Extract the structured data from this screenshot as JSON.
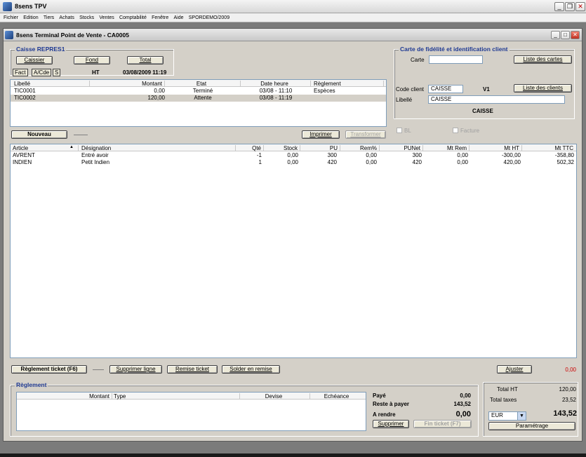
{
  "app": {
    "title": "8sens TPV"
  },
  "menu": [
    "Fichier",
    "Edition",
    "Tiers",
    "Achats",
    "Stocks",
    "Ventes",
    "Comptabilité",
    "Fenêtre",
    "Aide",
    "SPORDEMO/2009"
  ],
  "window": {
    "title": "8sens Terminal Point de Vente - CA0005"
  },
  "caisse": {
    "group_title": "Caisse  REPRES1",
    "btn_caissier": "Caissier",
    "btn_fond": "Fond",
    "btn_total": "Total",
    "tab_fact": "Fact",
    "tab_acde": "A/Cde",
    "tab_s": "S",
    "mode": "HT",
    "datetime": "03/08/2009 11:19"
  },
  "tickets": {
    "headers": [
      "Libellé",
      "Montant",
      "Etat",
      "Date heure",
      "Règlement"
    ],
    "rows": [
      [
        "TIC0001",
        "0,00",
        "Terminé",
        "03/08 - 11:10",
        "Espèces"
      ],
      [
        "TIC0002",
        "120,00",
        "Attente",
        "03/08 - 11:19",
        ""
      ]
    ]
  },
  "buttons": {
    "nouveau": "Nouveau",
    "imprimer": "Imprimer",
    "transformer": "Transformer",
    "reglement_ticket": "Règlement ticket (F6)",
    "supprimer_ligne": "Supprimer ligne",
    "remise_ticket": "Remise ticket",
    "solder": "Solder en remise",
    "ajuster": "Ajuster",
    "supprimer": "Supprimer",
    "fin_ticket": "Fin ticket (F7)",
    "parametrage": "Paramétrage"
  },
  "fidelite": {
    "group_title": "Carte de fidélité et identification client",
    "carte_label": "Carte",
    "carte_value": "",
    "liste_cartes": "Liste des cartes",
    "code_client_label": "Code client",
    "code_client_value": "CAISSE",
    "version": "V1",
    "liste_clients": "Liste des clients",
    "libelle_label": "Libellé",
    "libelle_value": "CAISSE",
    "client_name": "CAISSE",
    "bl": "BL",
    "facture": "Facture"
  },
  "articles": {
    "headers": [
      "Article",
      "Désignation",
      "Qté",
      "Stock",
      "PU",
      "Rem%",
      "PUNet",
      "Mt Rem",
      "Mt HT",
      "Mt TTC"
    ],
    "rows": [
      [
        "AVRENT",
        "Entré avoir",
        "-1",
        "0,00",
        "300",
        "0,00",
        "300",
        "0,00",
        "-300,00",
        "-358,80"
      ],
      [
        "INDIEN",
        "Petit Indien",
        "1",
        "0,00",
        "420",
        "0,00",
        "420",
        "0,00",
        "420,00",
        "502,32"
      ]
    ]
  },
  "ajuster_value": "0,00",
  "reglement": {
    "group_title": "Règlement",
    "headers": [
      "Montant",
      "Type",
      "Devise",
      "Echéance"
    ]
  },
  "paiement": {
    "paye_label": "Payé",
    "paye_value": "0,00",
    "reste_label": "Reste à payer",
    "reste_value": "143,52",
    "rendre_label": "A rendre",
    "rendre_value": "0,00"
  },
  "totals": {
    "ht_label": "Total HT",
    "ht_value": "120,00",
    "taxes_label": "Total taxes",
    "taxes_value": "23,52",
    "ttc_value": "143,52",
    "currency": "EUR"
  },
  "colors": {
    "accent": "#1f3a93",
    "red": "#cc0000"
  }
}
